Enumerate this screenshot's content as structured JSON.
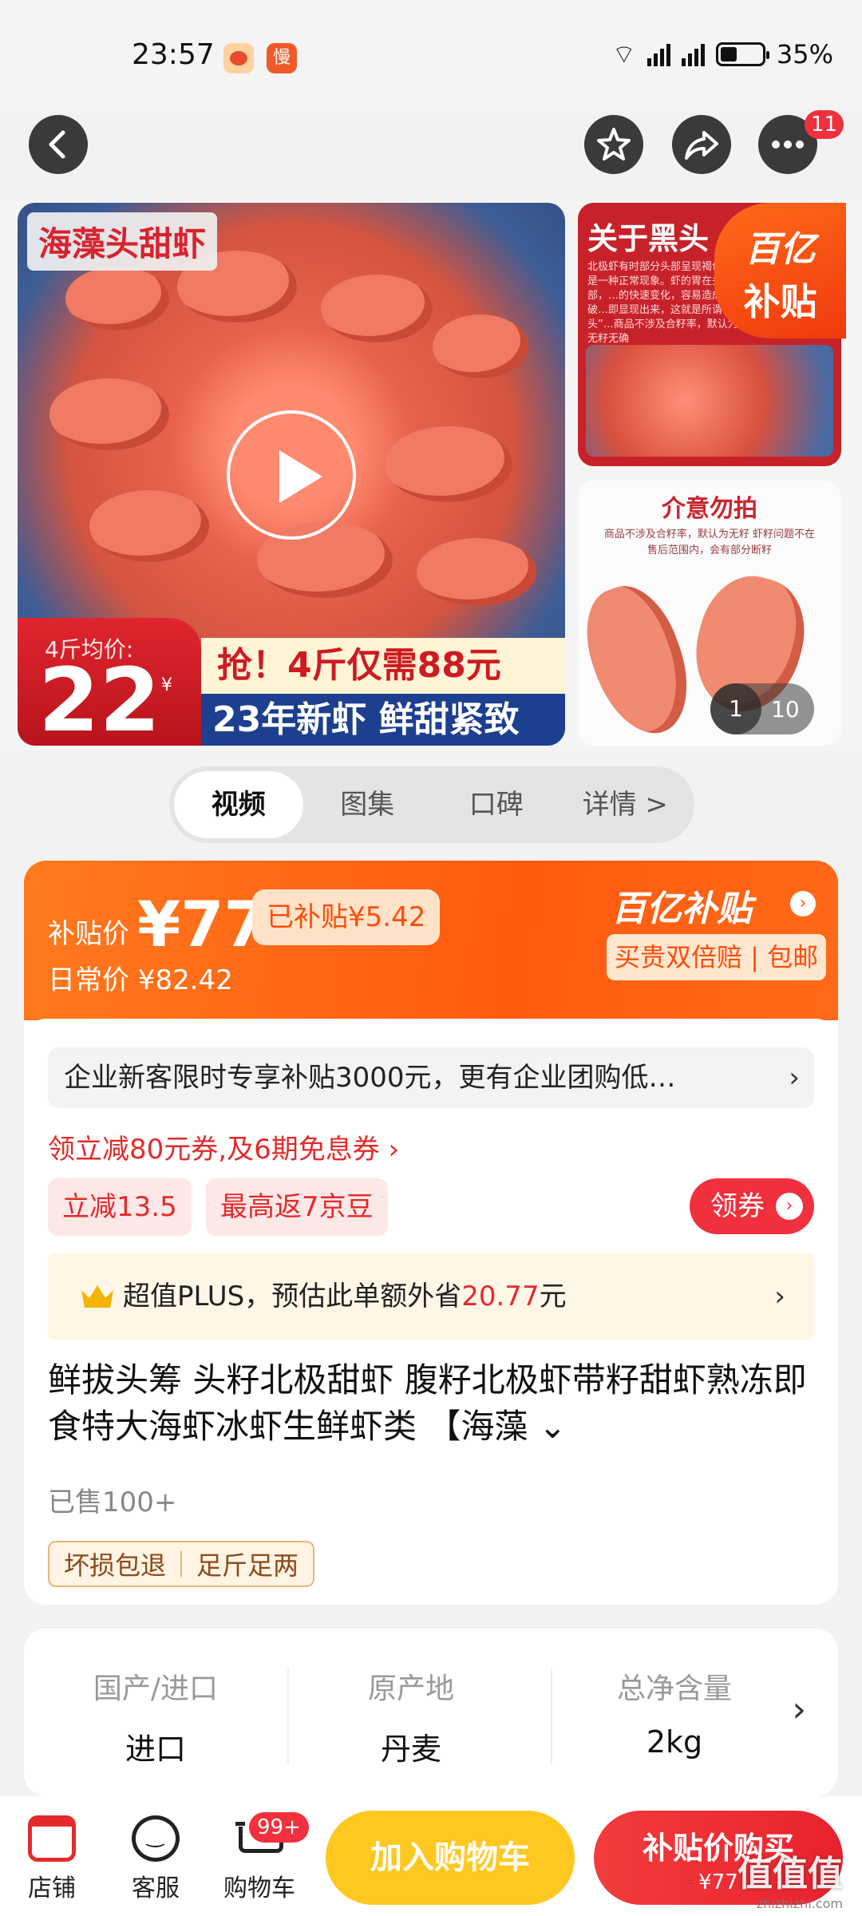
{
  "status_bar": {
    "time": "23:57",
    "app_icon_2_text": "慢",
    "network": "5G",
    "battery": "35%"
  },
  "nav": {
    "back_icon": "chevron-left-icon",
    "favorite_icon": "star-icon",
    "share_icon": "share-icon",
    "more_icon": "more-icon",
    "more_badge": "11"
  },
  "gallery": {
    "main_tag": "海藻头甜虾",
    "price_label": "4斤均价:",
    "price_value": "22",
    "price_unit": "¥",
    "banner_1": "抢！4斤仅需88元",
    "banner_2": "23年新虾 鲜甜紧致",
    "side1_title": "关于黑头",
    "side1_text": "北极虾有时部分头部呈现褐色，这是一种正常现象。虾的胃在头部，…的快速变化，容易造成虾头破…即显现出来，这就是所谓“黑头”…商品不涉及合籽率，默认为无籽无确",
    "subsidy_badge_line1": "百亿",
    "subsidy_badge_line2": "补贴",
    "side2_title": "介意勿拍",
    "side2_text": "商品不涉及合籽率，默认为无籽 虾籽问题不在售后范围内，会有部分断籽",
    "counter_current": "1",
    "counter_total": "10"
  },
  "tabs": [
    {
      "label": "视频",
      "active": true
    },
    {
      "label": "图集",
      "active": false
    },
    {
      "label": "口碑",
      "active": false
    },
    {
      "label": "详情 >",
      "active": false
    }
  ],
  "price": {
    "subsidy_label": "补贴价",
    "subsidy_price": "¥77",
    "subsidized_tag": "已补贴¥5.42",
    "daily_price": "日常价 ¥82.42",
    "brand": "百亿补贴",
    "guarantee": "买贵双倍赔 | 包邮"
  },
  "promo": {
    "enterprise_text": "企业新客限时专享补贴3000元，更有企业团购低…",
    "coupon_line": "领立减80元券,及6期免息券 ›",
    "tag_1": "立减13.5",
    "tag_2": "最高返7京豆",
    "get_coupon": "领券",
    "plus_text_prefix": "超值PLUS，预估此单额外省",
    "plus_amount": "20.77",
    "plus_suffix": "元"
  },
  "product": {
    "title": "鲜拔头筹 头籽北极甜虾 腹籽北极虾带籽甜虾熟冻即食特大海虾冰虾生鲜虾类 【海藻",
    "sold": "已售100+",
    "service_1": "坏损包退",
    "service_2": "足斤足两"
  },
  "specs": [
    {
      "key": "国产/进口",
      "value": "进口"
    },
    {
      "key": "原产地",
      "value": "丹麦"
    },
    {
      "key": "总净含量",
      "value": "2kg"
    }
  ],
  "bottom": {
    "shop": "店铺",
    "service": "客服",
    "cart": "购物车",
    "cart_badge": "99+",
    "add_to_cart": "加入购物车",
    "buy_line1": "补贴价购买",
    "buy_line2": "¥77",
    "watermark": "值值值",
    "watermark_url": "zhizhizhi.com"
  },
  "colors": {
    "accent_orange": "#ff5a10",
    "accent_red": "#e42a2a",
    "cart_yellow": "#ffc820"
  }
}
